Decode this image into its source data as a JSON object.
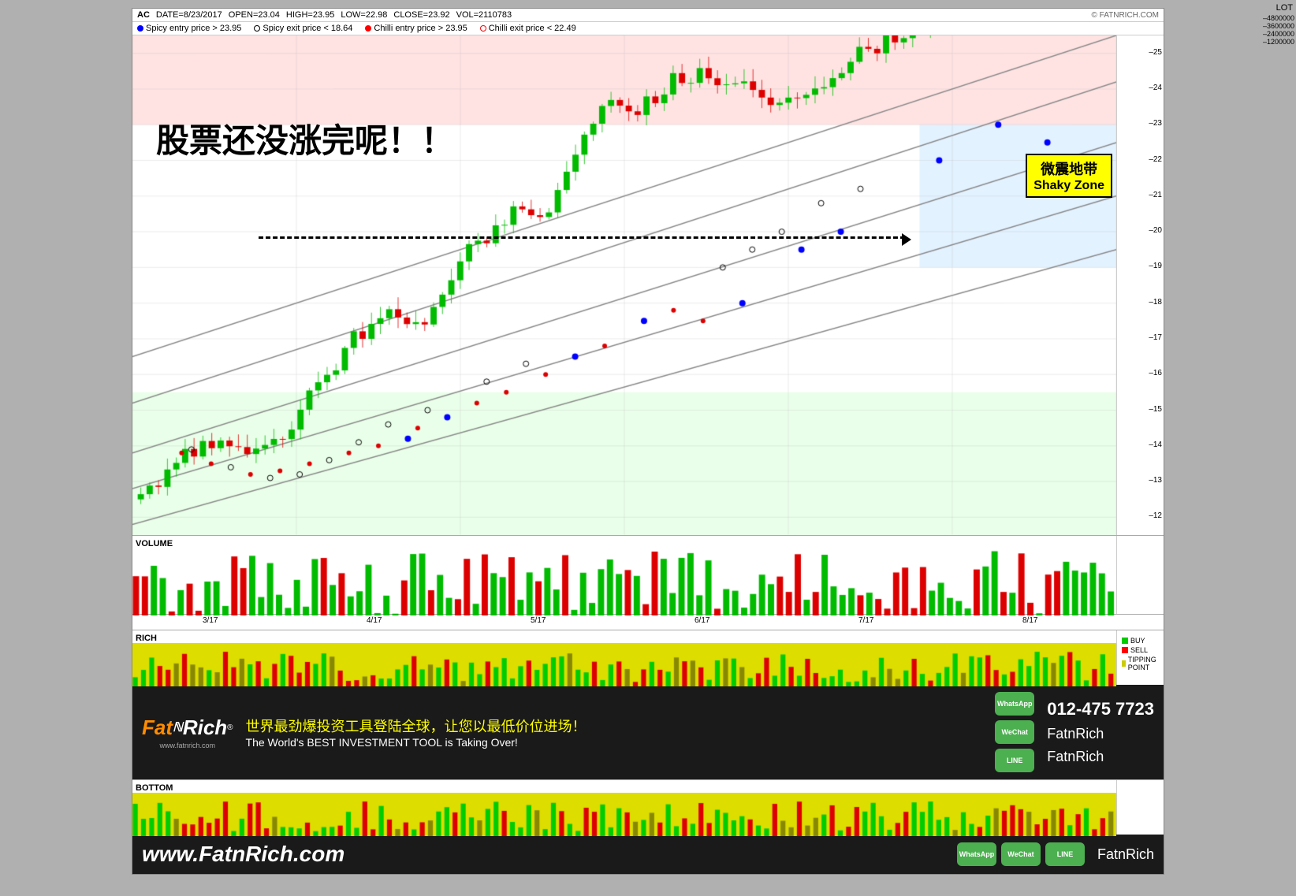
{
  "header": {
    "ticker": "AC",
    "date": "DATE=8/23/2017",
    "open": "OPEN=23.04",
    "high": "HIGH=23.95",
    "low": "LOW=22.98",
    "close": "CLOSE=23.92",
    "vol": "VOL=2110783",
    "watermark": "© FATNRICH.COM"
  },
  "legend": {
    "spicy_entry_label": "Spicy entry price > 23.95",
    "spicy_exit_label": "Spicy exit price < 18.64",
    "chilli_entry_label": "Chilli entry price > 23.95",
    "chilli_exit_label": "Chilli exit price < 22.49"
  },
  "chart_overlay": {
    "chinese_text": "股票还没涨完呢！！",
    "shaky_zone_chinese": "微震地带",
    "shaky_zone_english": "Shaky Zone"
  },
  "price_axis": {
    "values": [
      "25",
      "24",
      "23",
      "22",
      "21",
      "20",
      "19",
      "18",
      "17",
      "16",
      "15",
      "14",
      "13",
      "12"
    ]
  },
  "volume_axis": {
    "label": "VOLUME",
    "lot_label": "LOT",
    "values": [
      "4800000",
      "3600000",
      "2400000",
      "1200000"
    ]
  },
  "time_axis": {
    "labels": [
      "3/17",
      "4/17",
      "5/17",
      "6/17",
      "7/17",
      "8/17"
    ]
  },
  "rich_indicator": {
    "label": "RICH",
    "buy_label": "BUY",
    "sell_label": "SELL",
    "tipping_label": "TIPPING POINT"
  },
  "bottom_indicator": {
    "label": "BOTTOM"
  },
  "banner": {
    "registered": "®",
    "chinese_text": "世界最劲爆投资工具登陆全球，让您以最低价位进场！",
    "english_text": "The World's BEST INVESTMENT TOOL is Taking Over!",
    "phone": "012-475 7723",
    "contact1": "FatnRich",
    "contact2": "FatnRich",
    "whatsapp": "WhatsApp",
    "wechat": "WeChat",
    "line": "LINE",
    "url": "www.fatnrich.com"
  },
  "footer": {
    "website": "www.FatnRich.com"
  }
}
